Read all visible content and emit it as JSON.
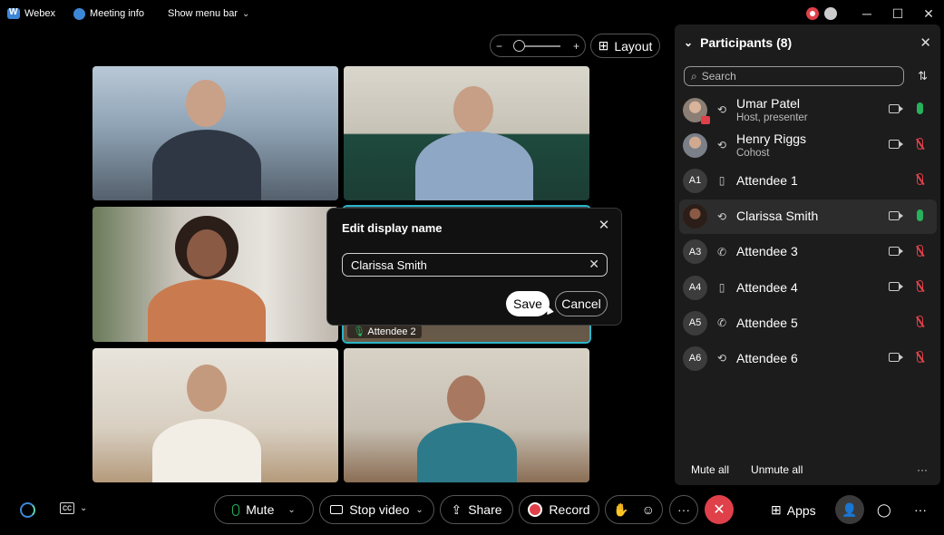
{
  "titlebar": {
    "app_name": "Webex",
    "meeting_info": "Meeting info",
    "menu_bar": "Show menu bar",
    "minimize": "─",
    "maximize": "☐",
    "close": "✕"
  },
  "zoom": {
    "minus": "−",
    "plus": "+"
  },
  "layout": {
    "label": "Layout",
    "icon": "grid-icon"
  },
  "tiles": [
    {
      "label": ""
    },
    {
      "label": ""
    },
    {
      "label": ""
    },
    {
      "label": "Attendee 2"
    },
    {
      "label": ""
    },
    {
      "label": ""
    }
  ],
  "dialog": {
    "title": "Edit display name",
    "value": "Clarissa Smith",
    "save": "Save",
    "cancel": "Cancel"
  },
  "participants": {
    "title": "Participants (8)",
    "search_placeholder": "Search",
    "mute_all": "Mute all",
    "unmute_all": "Unmute all",
    "more": "···",
    "list": [
      {
        "initials": "",
        "photo": "photo1",
        "name": "Umar Patel",
        "role": "Host, presenter",
        "device": "sync-icon",
        "video": true,
        "mic": "on"
      },
      {
        "initials": "",
        "photo": "photo2",
        "name": "Henry Riggs",
        "role": "Cohost",
        "device": "sync-icon",
        "video": true,
        "mic": "off"
      },
      {
        "initials": "A1",
        "name": "Attendee 1",
        "role": "",
        "device": "phone-icon",
        "video": false,
        "mic": "off"
      },
      {
        "initials": "",
        "photo": "photo3",
        "name": "Clarissa Smith",
        "role": "",
        "device": "sync-icon",
        "video": true,
        "mic": "on"
      },
      {
        "initials": "A3",
        "name": "Attendee 3",
        "role": "",
        "device": "handset-icon",
        "video": true,
        "mic": "off"
      },
      {
        "initials": "A4",
        "name": "Attendee 4",
        "role": "",
        "device": "phone-icon",
        "video": true,
        "mic": "off"
      },
      {
        "initials": "A5",
        "name": "Attendee 5",
        "role": "",
        "device": "handset-icon",
        "video": false,
        "mic": "off"
      },
      {
        "initials": "A6",
        "name": "Attendee 6",
        "role": "",
        "device": "sync-icon",
        "video": true,
        "mic": "off"
      }
    ]
  },
  "bottom": {
    "mute": "Mute",
    "stop_video": "Stop video",
    "share": "Share",
    "record": "Record",
    "apps": "Apps",
    "more": "···"
  },
  "colors": {
    "accent": "#3d87d8",
    "danger": "#e0404a",
    "mic_on": "#27b15b",
    "active_tile": "#2ab6c8"
  }
}
